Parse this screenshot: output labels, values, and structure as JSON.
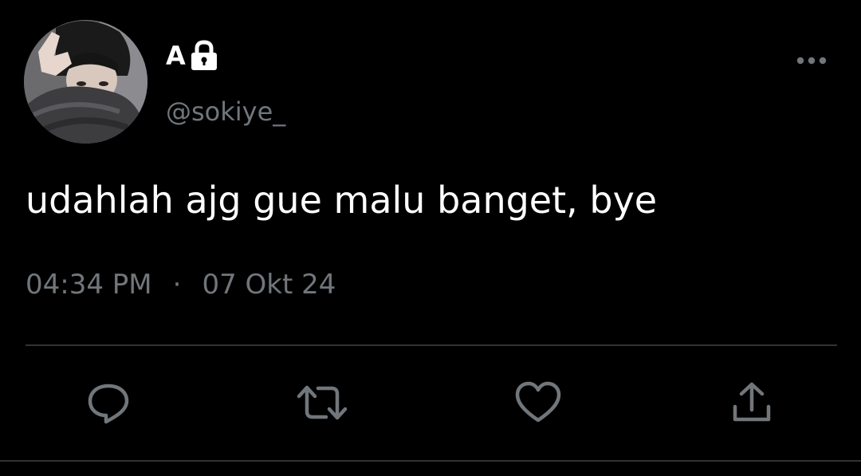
{
  "user": {
    "display_name": "A",
    "handle": "@sokiye_",
    "locked": true
  },
  "tweet": {
    "text": "udahlah ajg gue malu banget, bye",
    "time": "04:34 PM",
    "separator": "·",
    "date": "07 Okt 24"
  },
  "icons": {
    "more": "more-horizontal-icon",
    "lock": "lock-icon",
    "reply": "reply-icon",
    "retweet": "retweet-icon",
    "like": "heart-icon",
    "share": "share-icon"
  },
  "colors": {
    "background": "#000000",
    "primary_text": "#ffffff",
    "secondary_text": "#71767b",
    "divider": "#2f3336",
    "icon": "#71767b"
  }
}
